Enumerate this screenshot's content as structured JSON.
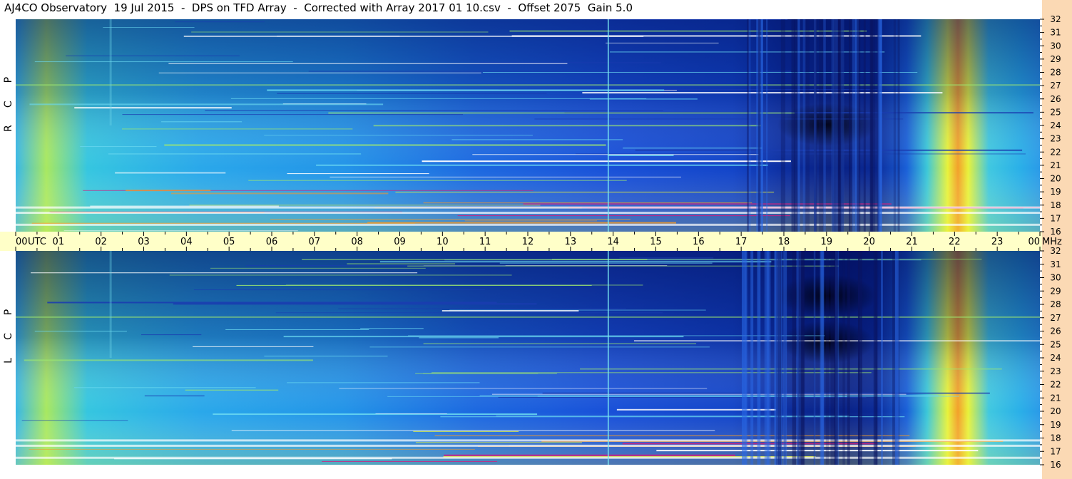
{
  "title": "AJ4CO Observatory  19 Jul 2015  -  DPS on TFD Array  -  Corrected with Array 2017 01 10.csv  -  Offset 2075  Gain 5.0",
  "chart_data": {
    "type": "heatmap",
    "x_label": "UTC",
    "x_ticks": [
      "00",
      "01",
      "02",
      "03",
      "04",
      "05",
      "06",
      "07",
      "08",
      "09",
      "10",
      "11",
      "12",
      "13",
      "14",
      "15",
      "16",
      "17",
      "18",
      "19",
      "20",
      "21",
      "22",
      "23",
      "00"
    ],
    "y_unit": "MHz",
    "y_ticks": [
      "16",
      "17",
      "18",
      "19",
      "20",
      "21",
      "22",
      "23",
      "24",
      "25",
      "26",
      "27",
      "28",
      "29",
      "30",
      "31",
      "32"
    ],
    "ylim": [
      16,
      32
    ],
    "panels": [
      {
        "label_letters": [
          "R",
          "C",
          "P"
        ]
      },
      {
        "label_letters": [
          "L",
          "C",
          "P"
        ]
      }
    ],
    "colors": {
      "axis_band": "#ffffc8",
      "right_margin": "#fbd9b4",
      "deep": "#0a1f9a",
      "mid": "#1e6be8",
      "light": "#35c6e0",
      "yellow": "#e8f23a",
      "orange": "#f29a2a",
      "white": "#ffffff"
    }
  }
}
